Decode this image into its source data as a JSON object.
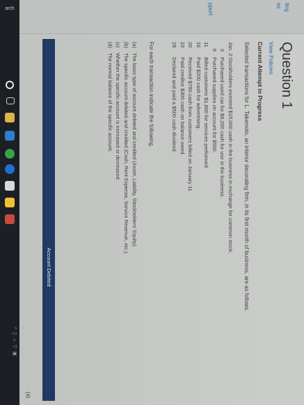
{
  "sidebar": {
    "links": [
      "ting",
      "es"
    ],
    "support": "pport"
  },
  "question": {
    "title": "Question 1",
    "view_policies": "View Policies",
    "attempt_status": "Current Attempt in Progress",
    "intro": "Selected transactions for L. Takemoto, an interior decorating firm, in its first month of business, are as follows.",
    "transactions": [
      {
        "date": "Jan. 2",
        "text": "Stockholders invested $15,000 cash in the business in exchange for common stock."
      },
      {
        "date": "3",
        "text": "Purchased used car for $8,200 cash for use in the business."
      },
      {
        "date": "9",
        "text": "Purchased supplies on account for $500."
      },
      {
        "date": "11",
        "text": "Billed customers $1,800 for services performed."
      },
      {
        "date": "16",
        "text": "Paid $200 cash for advertising."
      },
      {
        "date": "20",
        "text": "Received $780 cash from customers billed on January 11."
      },
      {
        "date": "23",
        "text": "Paid creditor $300 cash on balance owed."
      },
      {
        "date": "28",
        "text": "Declared and paid a $500 cash dividend."
      }
    ],
    "instruction": "For each transaction indicate the following.",
    "parts": [
      {
        "letter": "(a)",
        "text": "The basic type of account debited and credited (Asset, Liability, Stockholders' Equity)."
      },
      {
        "letter": "(b)",
        "text": "The specific account debited and credited (Cash, Rent Expense, Service Revenue, etc.)."
      },
      {
        "letter": "(c)",
        "text": "Whether the specific account is increased or decreased."
      },
      {
        "letter": "(d)",
        "text": "The normal balance of the specific account."
      }
    ],
    "table_header": "Account Debited",
    "row_letter": "(d)"
  },
  "taskbar": {
    "search_label": "arch",
    "icons": [
      "cortana-icon",
      "task-view-icon",
      "file-explorer-icon",
      "store-icon",
      "chrome-icon",
      "edge-icon",
      "mail-icon",
      "folder-icon",
      "app-icon"
    ],
    "tray": "^ ▭ ⌂ ◁ ▣"
  }
}
